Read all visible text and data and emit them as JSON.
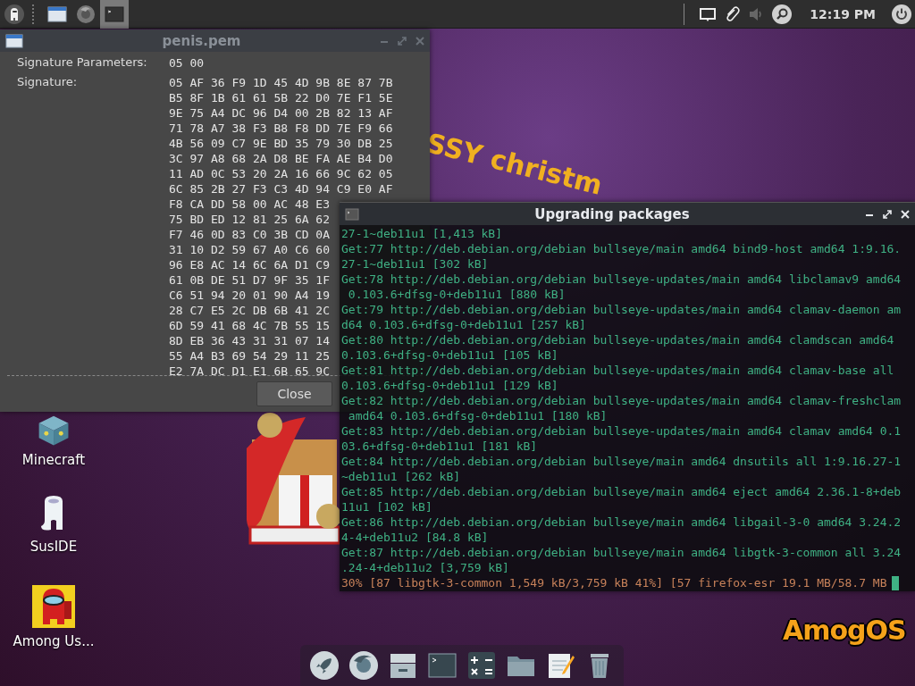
{
  "panel": {
    "launchers": [
      {
        "kind": "window",
        "selected": false
      },
      {
        "kind": "browser",
        "selected": false
      },
      {
        "kind": "terminal",
        "selected": true
      }
    ],
    "clock": "12:19 PM"
  },
  "wallpaper": {
    "greeting": "SSY christm",
    "logo": "AmogOS"
  },
  "desktop_icons": [
    {
      "kind": "minecraft",
      "label": "Minecraft"
    },
    {
      "kind": "suside",
      "label": "SusIDE"
    },
    {
      "kind": "among-us",
      "label": "Among Us..."
    }
  ],
  "cert_window": {
    "title": "penis.pem",
    "active": false,
    "fields": [
      {
        "label": "Signature Parameters:",
        "rows": [
          "05 00"
        ]
      },
      {
        "label": "Signature:",
        "rows": [
          "05 AF 36 F9 1D 45 4D 9B 8E 87 7B",
          "B5 8F 1B 61 61 5B 22 D0 7E F1 5E",
          "9E 75 A4 DC 96 D4 00 2B 82 13 AF",
          "71 78 A7 38 F3 B8 F8 DD 7E F9 66",
          "4B 56 09 C7 9E BD 35 79 30 DB 25",
          "3C 97 A8 68 2A D8 BE FA AE B4 D0",
          "11 AD 0C 53 20 2A 16 66 9C 62 05",
          "6C 85 2B 27 F3 C3 4D 94 C9 E0 AF",
          "F8 CA DD 58 00 AC 48 E3",
          "75 BD ED 12 81 25 6A 62",
          "F7 46 0D 83 C0 3B CD 0A",
          "31 10 D2 59 67 A0 C6 60",
          "96 E8 AC 14 6C 6A D1 C9",
          "61 0B DE 51 D7 9F 35 1F",
          "C6 51 94 20 01 90 A4 19",
          "28 C7 E5 2C DB 6B 41 2C",
          "6D 59 41 68 4C 7B 55 15",
          "8D EB 36 43 31 31 07 14",
          "55 A4 B3 69 54 29 11 25",
          "E2 7A DC D1 E1 6B 65 9C"
        ]
      }
    ],
    "close_button": "Close"
  },
  "terminal_window": {
    "title": "Upgrading packages",
    "active": true,
    "lines": [
      "27-1~deb11u1 [1,413 kB]",
      "Get:77 http://deb.debian.org/debian bullseye/main amd64 bind9-host amd64 1:9.16.",
      "27-1~deb11u1 [302 kB]",
      "Get:78 http://deb.debian.org/debian bullseye-updates/main amd64 libclamav9 amd64",
      " 0.103.6+dfsg-0+deb11u1 [880 kB]",
      "Get:79 http://deb.debian.org/debian bullseye-updates/main amd64 clamav-daemon am",
      "d64 0.103.6+dfsg-0+deb11u1 [257 kB]",
      "Get:80 http://deb.debian.org/debian bullseye-updates/main amd64 clamdscan amd64",
      "0.103.6+dfsg-0+deb11u1 [105 kB]",
      "Get:81 http://deb.debian.org/debian bullseye-updates/main amd64 clamav-base all",
      "0.103.6+dfsg-0+deb11u1 [129 kB]",
      "Get:82 http://deb.debian.org/debian bullseye-updates/main amd64 clamav-freshclam",
      " amd64 0.103.6+dfsg-0+deb11u1 [180 kB]",
      "Get:83 http://deb.debian.org/debian bullseye-updates/main amd64 clamav amd64 0.1",
      "03.6+dfsg-0+deb11u1 [181 kB]",
      "Get:84 http://deb.debian.org/debian bullseye/main amd64 dnsutils all 1:9.16.27-1",
      "~deb11u1 [262 kB]",
      "Get:85 http://deb.debian.org/debian bullseye/main amd64 eject amd64 2.36.1-8+deb",
      "11u1 [102 kB]",
      "Get:86 http://deb.debian.org/debian bullseye/main amd64 libgail-3-0 amd64 3.24.2",
      "4-4+deb11u2 [84.8 kB]",
      "Get:87 http://deb.debian.org/debian bullseye/main amd64 libgtk-3-common all 3.24",
      ".24-4+deb11u2 [3,759 kB]"
    ],
    "progress_line": "30% [87 libgtk-3-common 1,549 kB/3,759 kB 41%] [57 firefox-esr 19.1 MB/58.7 MB"
  },
  "dock": [
    {
      "kind": "rocket"
    },
    {
      "kind": "browser"
    },
    {
      "kind": "drawer"
    },
    {
      "kind": "terminal"
    },
    {
      "kind": "calculator"
    },
    {
      "kind": "folder"
    },
    {
      "kind": "notes"
    },
    {
      "kind": "trash"
    }
  ]
}
